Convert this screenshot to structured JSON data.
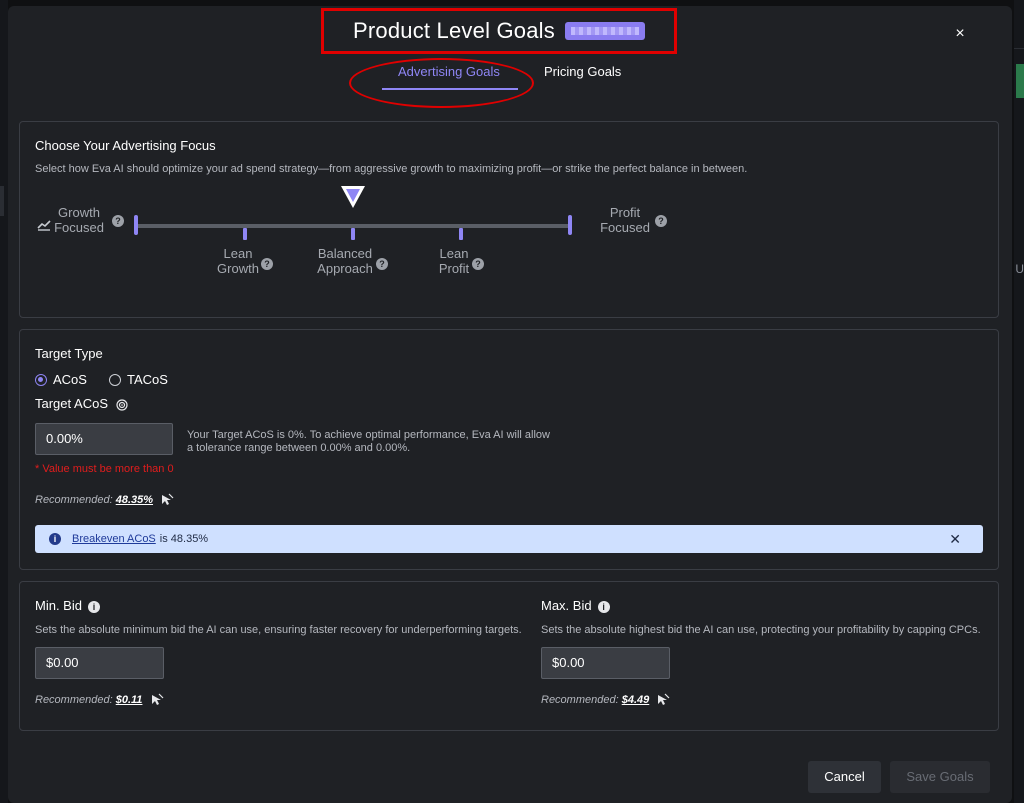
{
  "header": {
    "title": "Product Level Goals",
    "close_label": "×"
  },
  "tabs": [
    {
      "label": "Advertising Goals",
      "active": true
    },
    {
      "label": "Pricing Goals",
      "active": false
    }
  ],
  "focus": {
    "heading": "Choose Your Advertising Focus",
    "description": "Select how Eva AI should optimize your ad spend strategy—from aggressive growth to maximizing profit—or strike the perfect balance in between.",
    "left_label": [
      "Growth",
      "Focused"
    ],
    "right_label": [
      "Profit",
      "Focused"
    ],
    "stops": [
      {
        "line1": "Lean",
        "line2": "Growth"
      },
      {
        "line1": "Balanced",
        "line2": "Approach"
      },
      {
        "line1": "Lean",
        "line2": "Profit"
      }
    ],
    "selected_stop": "Balanced Approach",
    "help_glyph": "?"
  },
  "target": {
    "type_label": "Target Type",
    "options": [
      {
        "label": "ACoS",
        "selected": true
      },
      {
        "label": "TACoS",
        "selected": false
      }
    ],
    "acos_label": "Target ACoS",
    "acos_value": "0.00%",
    "tolerance_line1": "Your Target ACoS is 0%. To achieve optimal performance, Eva AI will allow",
    "tolerance_line2": "a tolerance range between 0.00% and 0.00%.",
    "error": "* Value must be more than 0",
    "recommended_label": "Recommended:",
    "recommended_value": "48.35%",
    "info_icon": "i",
    "info_link": "Breakeven ACoS",
    "info_text": "is 48.35%",
    "info_close": "✕"
  },
  "bids": {
    "min": {
      "label": "Min. Bid",
      "description": "Sets the absolute minimum bid the AI can use, ensuring faster recovery for underperforming targets.",
      "value": "$0.00",
      "recommended_label": "Recommended:",
      "recommended_value": "$0.11"
    },
    "max": {
      "label": "Max. Bid",
      "description": "Sets the absolute highest bid the AI can use, protecting your profitability by capping CPCs.",
      "value": "$0.00",
      "recommended_label": "Recommended:",
      "recommended_value": "$4.49"
    },
    "info_glyph": "i"
  },
  "footer": {
    "cancel": "Cancel",
    "save": "Save Goals"
  },
  "colors": {
    "accent": "#8f86f5",
    "error": "#e11d1d",
    "info_bg": "#cfe0ff",
    "highlight": "#e00000"
  }
}
